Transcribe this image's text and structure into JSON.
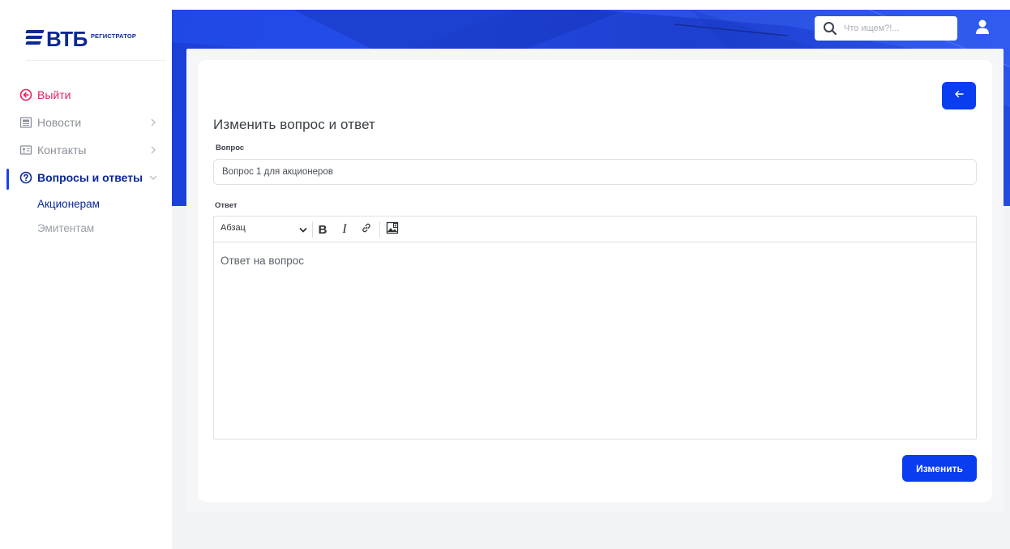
{
  "brand": {
    "logo_text": "ВТБ",
    "logo_sub": "РЕГИСТРАТОР"
  },
  "sidebar": {
    "items": [
      {
        "label": "Выйти",
        "icon": "exit-circle-arrow-icon"
      },
      {
        "label": "Новости",
        "icon": "newspaper-icon"
      },
      {
        "label": "Контакты",
        "icon": "contact-card-icon"
      },
      {
        "label": "Вопросы и ответы",
        "icon": "question-circle-icon"
      }
    ],
    "subitems": [
      {
        "label": "Акционерам"
      },
      {
        "label": "Эмитентам"
      }
    ]
  },
  "header": {
    "search_placeholder": "Что ищем?!..."
  },
  "form": {
    "title": "Изменить вопрос и ответ",
    "question_label": "Вопрос",
    "question_value": "Вопрос 1 для акционеров",
    "answer_label": "Ответ",
    "answer_value": "Ответ на вопрос",
    "toolbar": {
      "format_value": "Абзац",
      "bold": "B",
      "italic": "I"
    },
    "submit_label": "Изменить"
  },
  "colors": {
    "brand_blue": "#0a2896",
    "accent_blue": "#0a3cf0",
    "exit_red": "#e0245e",
    "banner_blue": "#1e3fd0"
  }
}
